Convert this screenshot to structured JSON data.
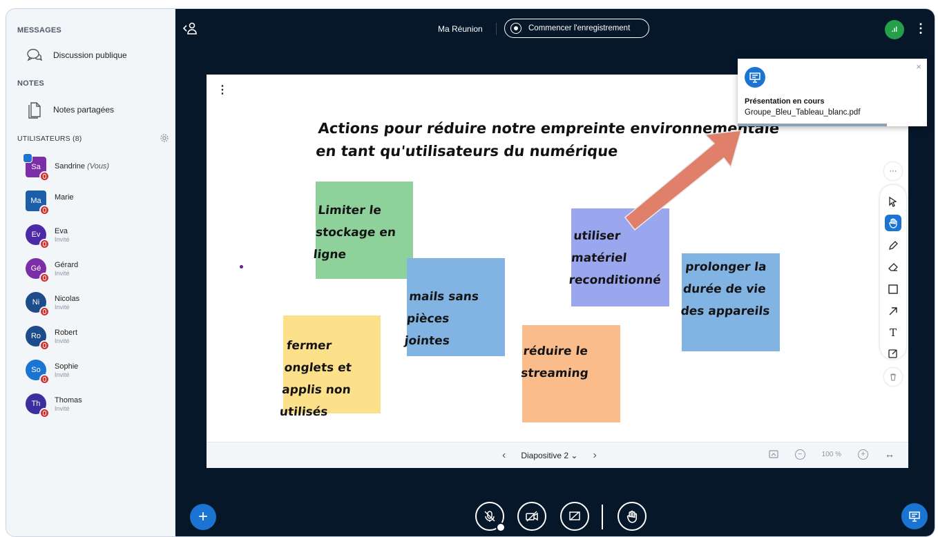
{
  "sidebar": {
    "messages_title": "MESSAGES",
    "public_chat": "Discussion publique",
    "notes_title": "NOTES",
    "shared_notes": "Notes partagées",
    "users_title": "UTILISATEURS (8)",
    "users": [
      {
        "initials": "Sa",
        "name": "Sandrine",
        "suffix": "(Vous)",
        "role": "",
        "color": "#7b2ea8"
      },
      {
        "initials": "Ma",
        "name": "Marie",
        "suffix": "",
        "role": "",
        "color": "#1c5fa8"
      },
      {
        "initials": "Ev",
        "name": "Eva",
        "suffix": "",
        "role": "Invité",
        "color": "#4b2aa8"
      },
      {
        "initials": "Gé",
        "name": "Gérard",
        "suffix": "",
        "role": "Invité",
        "color": "#7b2ea8"
      },
      {
        "initials": "Ni",
        "name": "Nicolas",
        "suffix": "",
        "role": "Invité",
        "color": "#1c4c8a"
      },
      {
        "initials": "Ro",
        "name": "Robert",
        "suffix": "",
        "role": "Invité",
        "color": "#1c4c8a"
      },
      {
        "initials": "So",
        "name": "Sophie",
        "suffix": "",
        "role": "Invité",
        "color": "#1b74d1"
      },
      {
        "initials": "Th",
        "name": "Thomas",
        "suffix": "",
        "role": "Invité",
        "color": "#3b2e9e"
      }
    ]
  },
  "topbar": {
    "meeting_title": "Ma Réunion",
    "record_label": "Commencer l'enregistrement",
    "connection_icon": "signal-bars-icon",
    "connection_text": ".ıl"
  },
  "slide": {
    "title": "Actions pour réduire notre empreinte environnementale en tant qu'utilisateurs du numérique",
    "notes": [
      {
        "text": "Limiter le stockage en ligne",
        "color": "#8ed19b"
      },
      {
        "text": "mails sans pièces jointes",
        "color": "#82b4e3"
      },
      {
        "text": "utiliser matériel reconditionné",
        "color": "#9aa6ee"
      },
      {
        "text": "prolonger la durée de vie des appareils",
        "color": "#82b4e3"
      },
      {
        "text": "fermer onglets et applis non utilisés",
        "color": "#fde08a"
      },
      {
        "text": "réduire le streaming",
        "color": "#fbbc8c"
      }
    ],
    "nav_label": "Diapositive 2",
    "zoom": "100 %"
  },
  "popup": {
    "title": "Présentation en cours",
    "file": "Groupe_Bleu_Tableau_blanc.pdf",
    "close": "×"
  },
  "tools": [
    "select",
    "hand",
    "pencil",
    "eraser",
    "rectangle",
    "arrow",
    "text",
    "note"
  ],
  "colors": {
    "accent": "#1b74d1",
    "background": "#06172a",
    "mute": "#d32f2f",
    "annotation": "#e07f6a"
  }
}
